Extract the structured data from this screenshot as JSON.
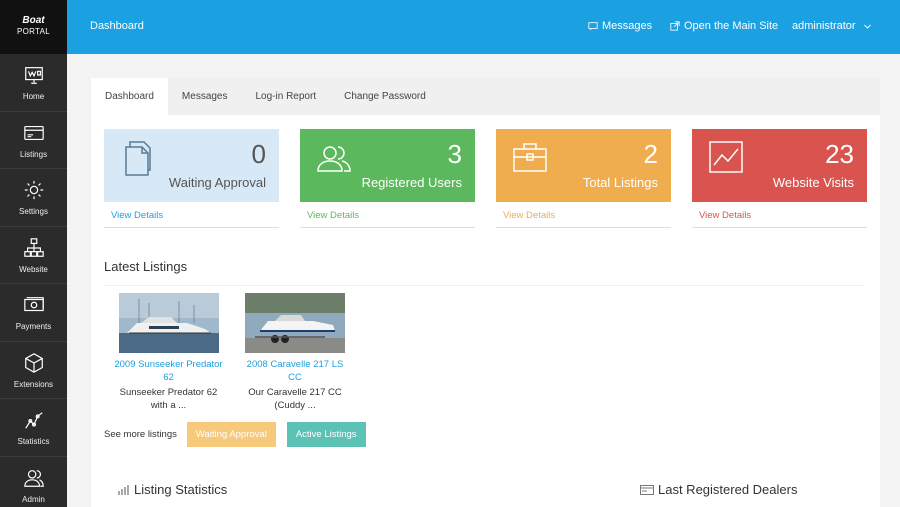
{
  "brand": {
    "line1": "Boat",
    "line2": "PORTAL"
  },
  "sidebar": {
    "items": [
      {
        "label": "Home",
        "icon": "home-icon"
      },
      {
        "label": "Listings",
        "icon": "listings-icon"
      },
      {
        "label": "Settings",
        "icon": "gear-icon"
      },
      {
        "label": "Website",
        "icon": "sitemap-icon"
      },
      {
        "label": "Payments",
        "icon": "money-icon"
      },
      {
        "label": "Extensions",
        "icon": "cube-icon"
      },
      {
        "label": "Statistics",
        "icon": "line-chart-icon"
      },
      {
        "label": "Admin",
        "icon": "users-icon"
      }
    ]
  },
  "topbar": {
    "breadcrumb": "Dashboard",
    "messages": "Messages",
    "main_site": "Open the Main Site",
    "user": "administrator"
  },
  "tabs": [
    "Dashboard",
    "Messages",
    "Log-in Report",
    "Change Password"
  ],
  "cards": [
    {
      "value": "0",
      "title": "Waiting Approval",
      "link": "View Details",
      "color": "#d7e9f6",
      "link_color": "#1ba0e1",
      "icon": "documents-icon"
    },
    {
      "value": "3",
      "title": "Registered Users",
      "link": "View Details",
      "color": "#5cb85c",
      "link_color": "#5cb85c",
      "icon": "users-icon"
    },
    {
      "value": "2",
      "title": "Total Listings",
      "link": "View Details",
      "color": "#f0ad4e",
      "link_color": "#f0ad4e",
      "icon": "briefcase-icon"
    },
    {
      "value": "23",
      "title": "Website Visits",
      "link": "View Details",
      "color": "#d9534f",
      "link_color": "#d9534f",
      "icon": "area-chart-icon"
    }
  ],
  "latest": {
    "title": "Latest Listings",
    "items": [
      {
        "name": "2009 Sunseeker Predator 62",
        "desc": "Sunseeker Predator 62 with a ..."
      },
      {
        "name": "2008 Caravelle 217 LS CC",
        "desc": "Our Caravelle 217 CC (Cuddy ..."
      }
    ],
    "see_more": "See more listings",
    "btn_waiting": "Waiting Approval",
    "btn_active": "Active Listings"
  },
  "bottom": {
    "listing_stats": "Listing Statistics",
    "dealers": "Last Registered Dealers"
  }
}
